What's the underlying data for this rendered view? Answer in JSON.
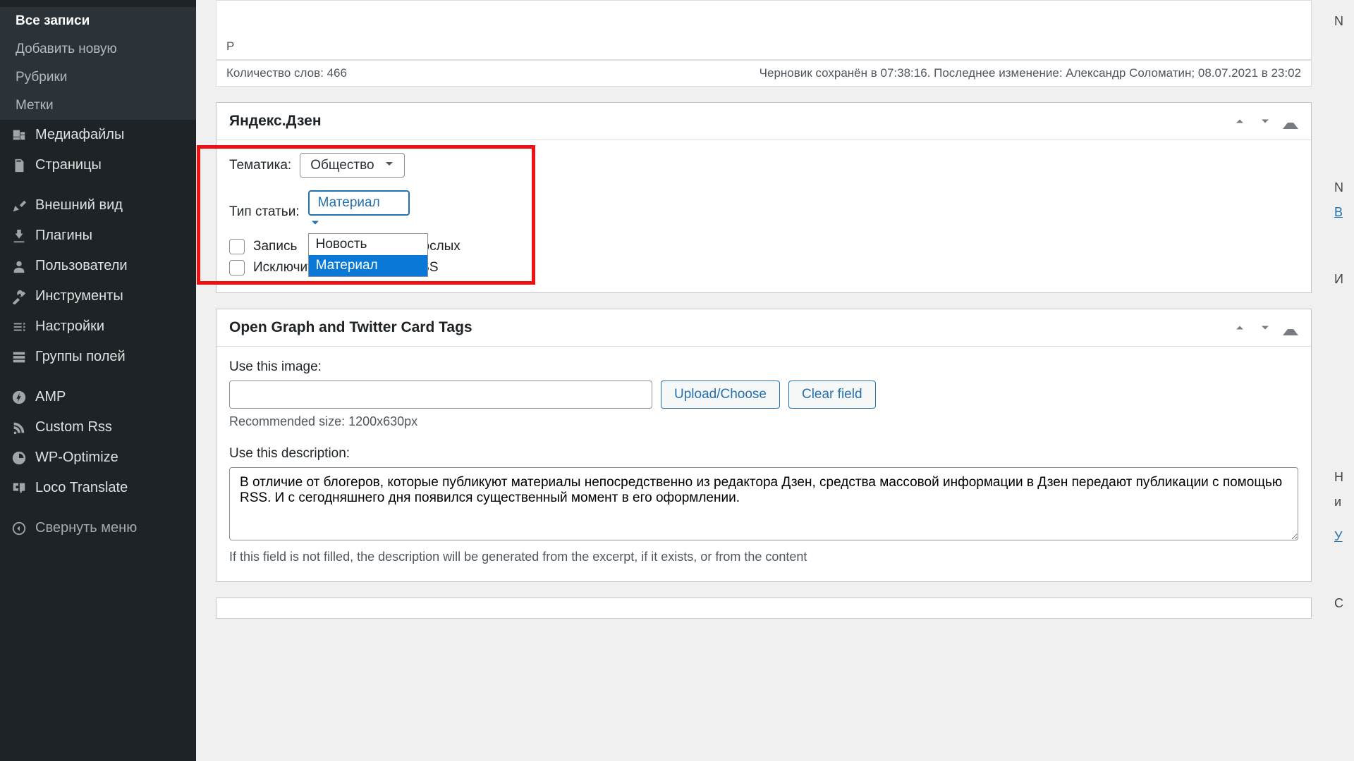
{
  "sidebar": {
    "sub": [
      {
        "label": "Все записи",
        "selected": true
      },
      {
        "label": "Добавить новую"
      },
      {
        "label": "Рубрики"
      },
      {
        "label": "Метки"
      }
    ],
    "items": [
      {
        "label": "Медиафайлы",
        "icon": "media"
      },
      {
        "label": "Страницы",
        "icon": "pages"
      },
      {
        "label": "Внешний вид",
        "icon": "appearance",
        "gap": true
      },
      {
        "label": "Плагины",
        "icon": "plugins"
      },
      {
        "label": "Пользователи",
        "icon": "users"
      },
      {
        "label": "Инструменты",
        "icon": "tools"
      },
      {
        "label": "Настройки",
        "icon": "settings"
      },
      {
        "label": "Группы полей",
        "icon": "fields"
      },
      {
        "label": "AMP",
        "icon": "amp",
        "gap": true
      },
      {
        "label": "Custom Rss",
        "icon": "rss"
      },
      {
        "label": "WP-Optimize",
        "icon": "optimize"
      },
      {
        "label": "Loco Translate",
        "icon": "loco"
      }
    ],
    "collapse": "Свернуть меню"
  },
  "editor": {
    "path": "P",
    "wordcount_label": "Количество слов:",
    "wordcount_value": "466",
    "save_status": "Черновик сохранён в 07:38:16. Последнее изменение: Александр Соломатин; 08.07.2021 в 23:02"
  },
  "zen": {
    "title": "Яндекс.Дзен",
    "theme_label": "Тематика:",
    "theme_value": "Общество",
    "type_label": "Тип статьи:",
    "type_value": "Материал",
    "options": [
      "Новость",
      "Материал"
    ],
    "cb1_left": "Запись",
    "cb1_right": "взрослых",
    "cb2": "Исключить эту запись из RSS"
  },
  "og": {
    "title": "Open Graph and Twitter Card Tags",
    "image_label": "Use this image:",
    "image_value": "",
    "upload_btn": "Upload/Choose",
    "clear_btn": "Clear field",
    "rec_size": "Recommended size: 1200x630px",
    "desc_label": "Use this description:",
    "desc_value": "В отличие от блогеров, которые публикуют материалы непосредственно из редактора Дзен, средства массовой информации в Дзен передают публикации с помощью RSS. И с сегодняшнего дня появился существенный момент в его оформлении.",
    "desc_hint": "If this field is not filled, the description will be generated from the excerpt, if it exists, or from the content"
  },
  "rcol": {
    "a": "N",
    "b": "N",
    "c": "В",
    "d": "И",
    "e": "Н",
    "f": "и",
    "g": "У",
    "h": "С"
  }
}
